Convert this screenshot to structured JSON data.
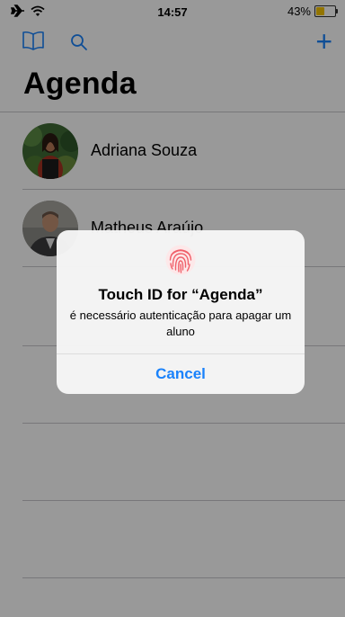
{
  "status_bar": {
    "time": "14:57",
    "battery_percent_text": "43%",
    "battery_level": 0.43,
    "battery_color": "#f5c400"
  },
  "nav": {
    "left_icons": [
      "bookmarks-icon",
      "search-icon"
    ],
    "right_icon": "plus-icon",
    "add_symbol": "+",
    "tint_color": "#1a82fb"
  },
  "title": "Agenda",
  "contacts": [
    {
      "name": "Adriana Souza",
      "avatar": "photo-woman"
    },
    {
      "name": "Matheus Araújo",
      "avatar": "photo-man"
    }
  ],
  "alert": {
    "icon": "fingerprint-icon",
    "icon_color": "#f0606a",
    "title": "Touch ID for “Agenda”",
    "message": "é necessário autenticação para apagar um aluno",
    "button": "Cancel"
  }
}
